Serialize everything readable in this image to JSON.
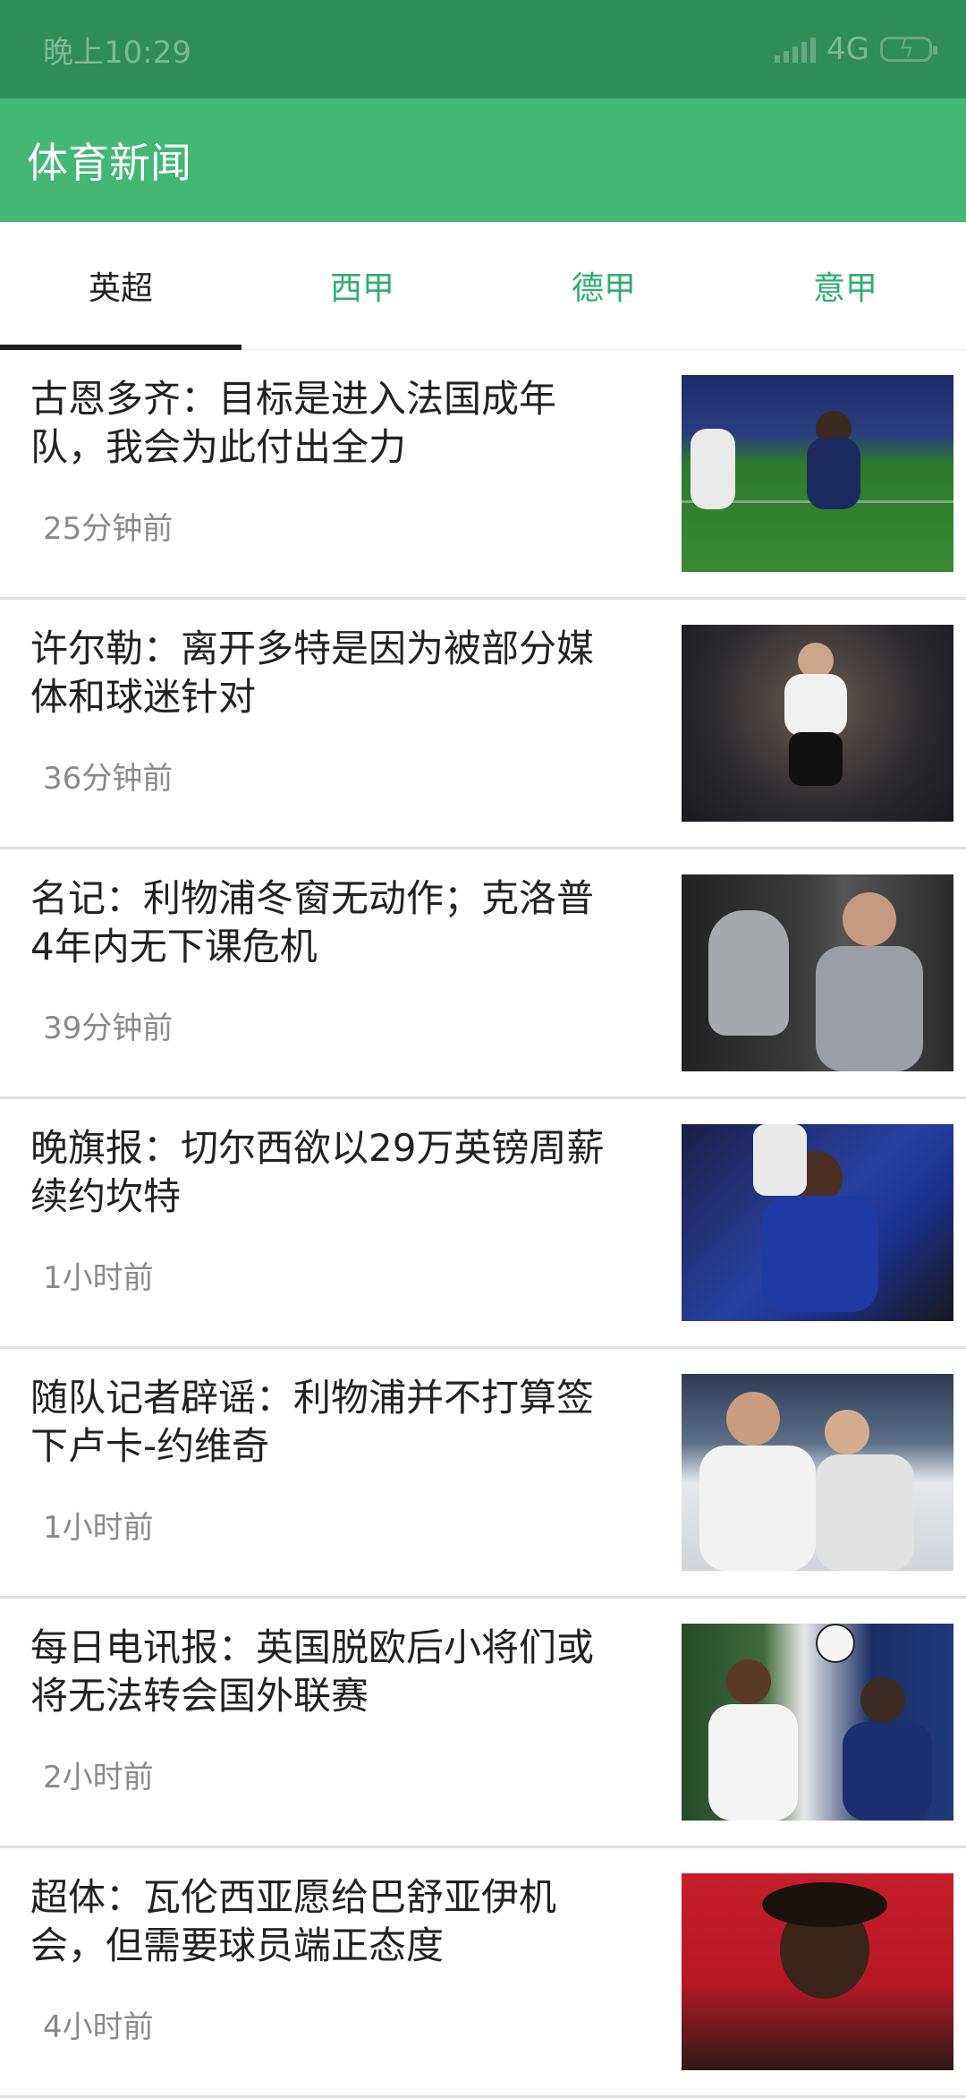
{
  "status_bar": {
    "time": "晚上10:29",
    "network": "4G",
    "network_icon": "signal-icon",
    "battery_icon": "battery-charging-icon"
  },
  "app_bar": {
    "title": "体育新闻"
  },
  "tabs": [
    {
      "label": "英超",
      "active": true
    },
    {
      "label": "西甲",
      "active": false
    },
    {
      "label": "德甲",
      "active": false
    },
    {
      "label": "意甲",
      "active": false
    }
  ],
  "news": [
    {
      "title": "古恩多齐：目标是进入法国成年队，我会为此付出全力",
      "time": "25分钟前"
    },
    {
      "title": "许尔勒：离开多特是因为被部分媒体和球迷针对",
      "time": "36分钟前"
    },
    {
      "title": "名记：利物浦冬窗无动作；克洛普4年内无下课危机",
      "time": "39分钟前"
    },
    {
      "title": "晚旗报：切尔西欲以29万英镑周薪续约坎特",
      "time": "1小时前"
    },
    {
      "title": "随队记者辟谣：利物浦并不打算签下卢卡-约维奇",
      "time": "1小时前"
    },
    {
      "title": "每日电讯报：英国脱欧后小将们或将无法转会国外联赛",
      "time": "2小时前"
    },
    {
      "title": "超体：瓦伦西亚愿给巴舒亚伊机会，但需要球员端正态度",
      "time": "4小时前"
    }
  ],
  "colors": {
    "status_bar": "#2f8d59",
    "app_bar": "#42b874",
    "tab_inactive": "#2fae6d",
    "tab_active": "#222222"
  }
}
